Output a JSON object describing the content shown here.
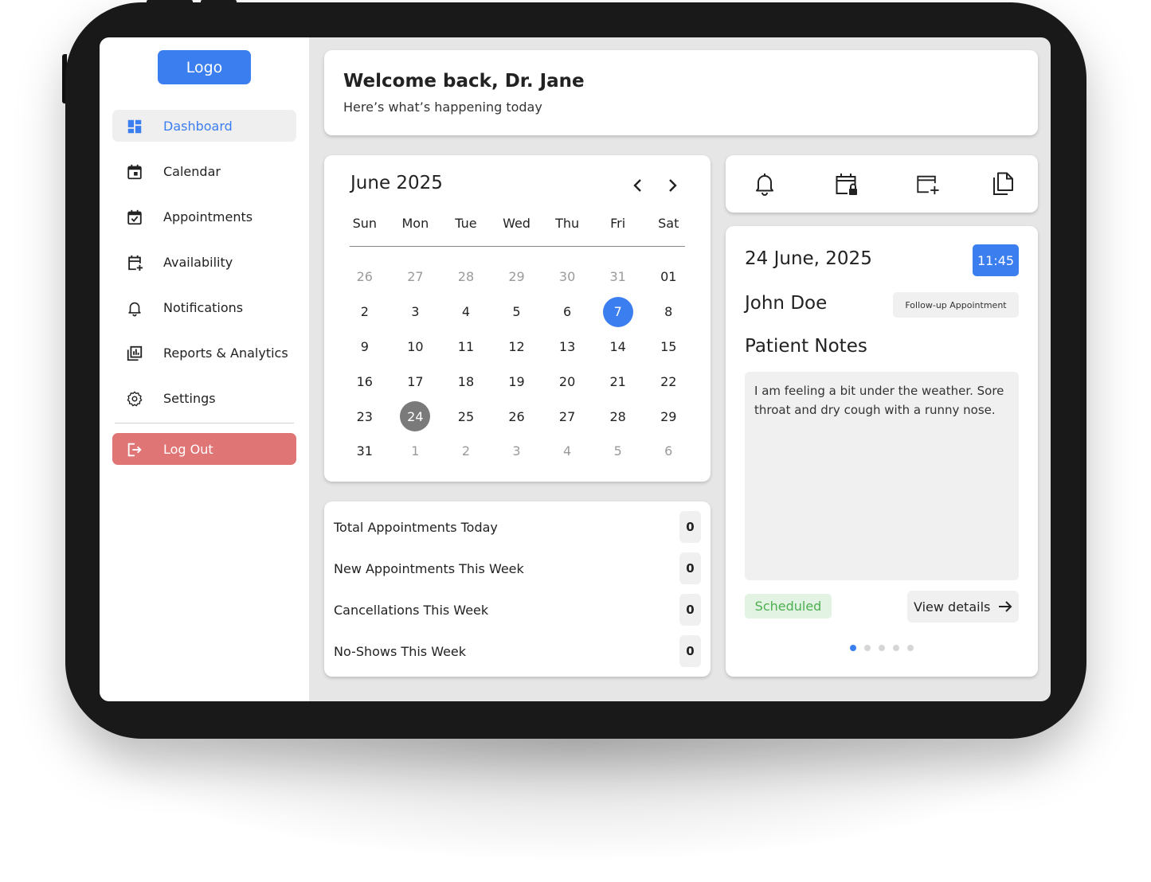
{
  "sidebar": {
    "logo": "Logo",
    "items": [
      {
        "label": "Dashboard",
        "icon": "dashboard-icon"
      },
      {
        "label": "Calendar",
        "icon": "calendar-icon"
      },
      {
        "label": "Appointments",
        "icon": "appointments-icon"
      },
      {
        "label": "Availability",
        "icon": "availability-icon"
      },
      {
        "label": "Notifications",
        "icon": "bell-icon"
      },
      {
        "label": "Reports & Analytics",
        "icon": "analytics-icon"
      },
      {
        "label": "Settings",
        "icon": "gear-icon"
      }
    ],
    "logout": "Log Out",
    "active_item": "Dashboard"
  },
  "header": {
    "title": "Welcome back, Dr. Jane",
    "subtitle": "Here’s what’s happening today"
  },
  "calendar": {
    "month_label": "June 2025",
    "weekdays": [
      "Sun",
      "Mon",
      "Tue",
      "Wed",
      "Thu",
      "Fri",
      "Sat"
    ],
    "weeks": [
      [
        "26",
        "27",
        "28",
        "29",
        "30",
        "31",
        "01"
      ],
      [
        "2",
        "3",
        "4",
        "5",
        "6",
        "7",
        "8"
      ],
      [
        "9",
        "10",
        "11",
        "12",
        "13",
        "14",
        "15"
      ],
      [
        "16",
        "17",
        "18",
        "19",
        "20",
        "21",
        "22"
      ],
      [
        "23",
        "24",
        "25",
        "26",
        "27",
        "28",
        "29"
      ],
      [
        "31",
        "1",
        "2",
        "3",
        "4",
        "5",
        "6"
      ]
    ],
    "selected_day": "7",
    "today_day": "24"
  },
  "stats": {
    "rows": [
      {
        "label": "Total Appointments Today",
        "value": "0"
      },
      {
        "label": "New Appointments This Week",
        "value": "0"
      },
      {
        "label": "Cancellations This Week",
        "value": "0"
      },
      {
        "label": "No-Shows This Week",
        "value": "0"
      }
    ]
  },
  "quick_actions": [
    "bell-icon",
    "calendar-lock-icon",
    "add-to-calendar-icon",
    "documents-icon"
  ],
  "appointment": {
    "date": "24 June, 2025",
    "time": "11:45",
    "patient": "John Doe",
    "type": "Follow-up Appointment",
    "notes_title": "Patient Notes",
    "notes": "I am feeling a bit under the weather. Sore throat and dry cough with a runny nose.",
    "status": "Scheduled",
    "view_details": "View details",
    "page_count": 5,
    "current_page": 1
  },
  "colors": {
    "accent": "#3b7ef0",
    "danger": "#e07575",
    "success": "#4caf50",
    "today": "#7a7a7a"
  }
}
